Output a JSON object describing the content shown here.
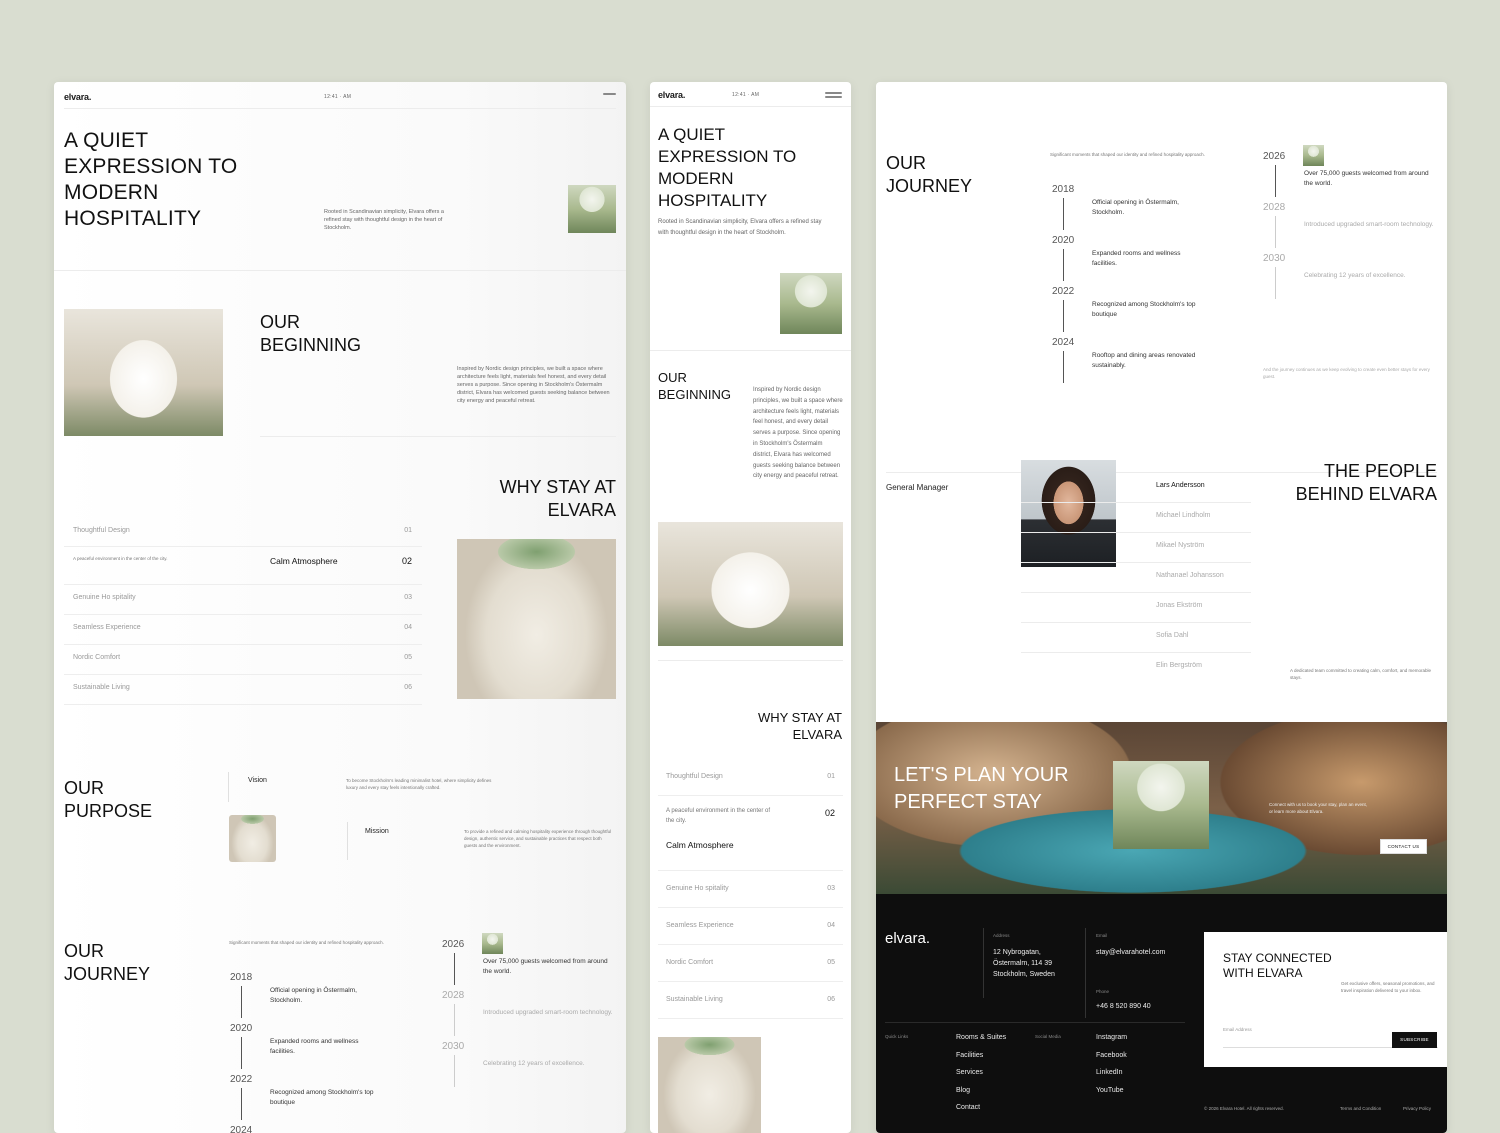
{
  "brand": "elvara.",
  "time": "12:41 · AM",
  "hero": {
    "title": "A QUIET EXPRESSION TO MODERN HOSPITALITY",
    "desc_desktop": "Rooted in Scandinavian simplicity, Elvara offers a refined stay with thoughtful design in the heart of Stockholm.",
    "desc_mobile": "Rooted in Scandinavian simplicity, Elvara offers a refined stay with thoughtful design in the heart of Stockholm."
  },
  "beginning": {
    "title": "OUR BEGINNING",
    "text": "Inspired by Nordic design principles, we built a space where architecture feels light, materials feel honest, and every detail serves a purpose. Since opening in Stockholm's Östermalm district, Elvara has welcomed guests seeking balance between city energy and peaceful retreat."
  },
  "why": {
    "title": "WHY STAY AT ELVARA",
    "items": [
      {
        "label": "Thoughtful Design",
        "num": "01"
      },
      {
        "label": "Calm Atmosphere",
        "num": "02",
        "desc": "A peaceful environment in the center of the city."
      },
      {
        "label": "Genuine Ho spitality",
        "num": "03"
      },
      {
        "label": "Seamless Experience",
        "num": "04"
      },
      {
        "label": "Nordic Comfort",
        "num": "05"
      },
      {
        "label": "Sustainable Living",
        "num": "06"
      }
    ]
  },
  "purpose": {
    "title": "OUR PURPOSE",
    "vision_label": "Vision",
    "vision_text": "To become Stockholm's leading minimalist hotel, where simplicity defines luxury and every stay feels intentionally crafted.",
    "mission_label": "Mission",
    "mission_text": "To provide a refined and calming hospitality experience through thoughtful design, authentic service, and sustainable practices that respect both guests and the environment."
  },
  "journey": {
    "title": "OUR JOURNEY",
    "intro": "Significant moments that shaped our identity and refined hospitality approach.",
    "milestones": [
      {
        "year": "2018",
        "text": "Official opening in Östermalm, Stockholm."
      },
      {
        "year": "2020",
        "text": "Expanded rooms and wellness facilities."
      },
      {
        "year": "2022",
        "text": "Recognized among Stockholm's top boutique"
      },
      {
        "year": "2024",
        "text": "Rooftop and dining areas renovated sustainably."
      }
    ],
    "future": [
      {
        "year": "2026",
        "text": "Over 75,000 guests welcomed from around the world."
      },
      {
        "year": "2028",
        "text": "Introduced upgraded smart-room technology."
      },
      {
        "year": "2030",
        "text": "Celebrating 12 years of excellence."
      }
    ],
    "outro": "And the journey continues as we keep evolving to create even better stays for every guest."
  },
  "people": {
    "title": "THE PEOPLE BEHIND ELVARA",
    "role": "General Manager",
    "names": [
      "Lars Andersson",
      "Michael Lindholm",
      "Mikael Nyström",
      "Nathanael Johansson",
      "Jonas Ekström",
      "Sofia Dahl",
      "Elin Bergström"
    ],
    "caption": "A dedicated team committed to creating calm, comfort, and memorable stays."
  },
  "plan": {
    "title": "LET'S PLAN YOUR PERFECT STAY",
    "text": "Connect with us to book your stay, plan an event, or learn more about Elvara.",
    "cta": "CONTACT US"
  },
  "footer": {
    "brand": "elvara.",
    "address_label": "Address",
    "address": "12 Nybrogatan, Östermalm, 114 39 Stockholm, Sweden",
    "email_label": "Email",
    "email": "stay@elvarahotel.com",
    "phone_label": "Phone",
    "phone": "+46 8 520 890 40",
    "quick_label": "Quick Links",
    "quick_links": [
      "Rooms & Suites",
      "Facilities",
      "Services",
      "Blog",
      "Contact"
    ],
    "social_label": "Social Media",
    "social_links": [
      "Instagram",
      "Facebook",
      "LinkedIn",
      "YouTube"
    ],
    "copyright": "© 2026 Elvara Hotel. All rights reserved.",
    "terms": "Terms and Condition",
    "privacy": "Privacy Policy"
  },
  "newsletter": {
    "title": "STAY CONNECTED WITH ELVARA",
    "text": "Get exclusive offers, seasonal promotions, and travel inspiration delivered to your inbox.",
    "placeholder": "Email Address",
    "button": "SUBSCRIBE"
  }
}
